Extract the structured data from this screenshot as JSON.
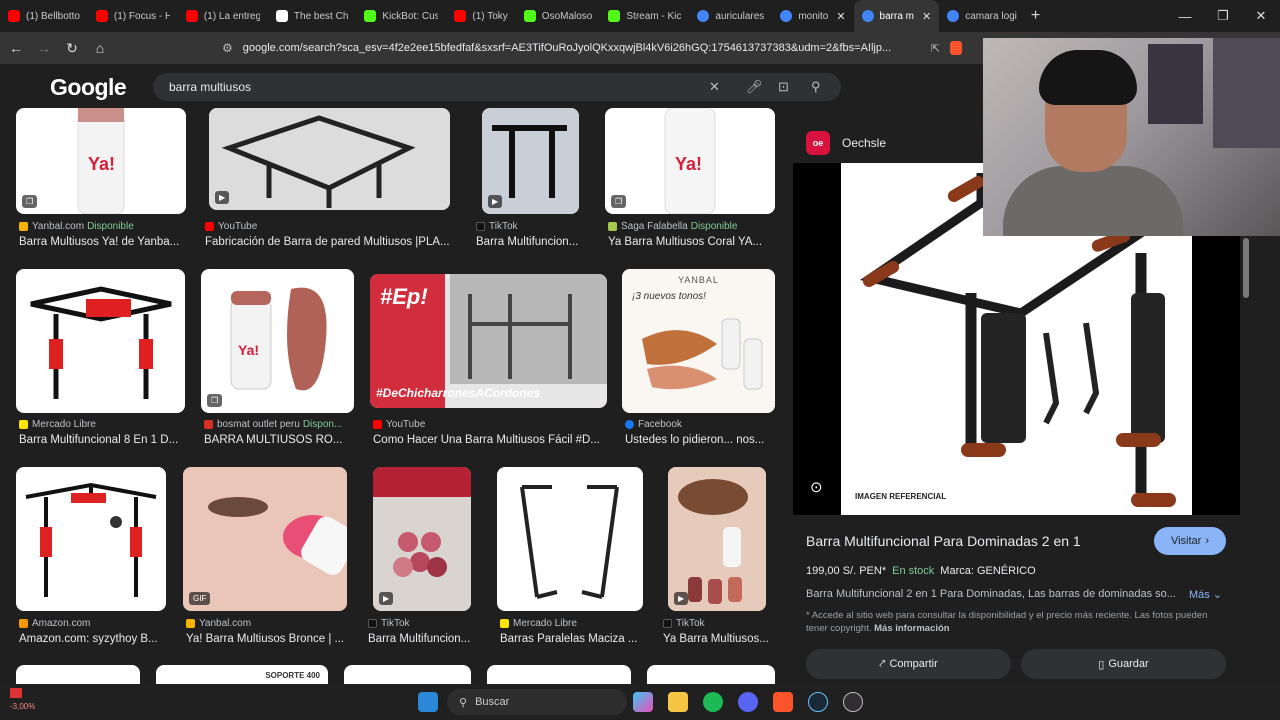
{
  "tabs": [
    {
      "title": "(1) Bellbotto",
      "color": "#ff0000"
    },
    {
      "title": "(1) Focus - H",
      "color": "#ff0000"
    },
    {
      "title": "(1) La entreg",
      "color": "#ff0000"
    },
    {
      "title": "The best Ch",
      "color": "#ffffff"
    },
    {
      "title": "KickBot: Cus",
      "color": "#53fc18"
    },
    {
      "title": "(1) Toky",
      "color": "#ff0000"
    },
    {
      "title": "OsoMaloso",
      "color": "#53fc18"
    },
    {
      "title": "Stream - Kic",
      "color": "#53fc18"
    },
    {
      "title": "auriculares",
      "color": "#4285f4"
    },
    {
      "title": "monito",
      "color": "#4285f4"
    },
    {
      "title": "barra m",
      "color": "#4285f4"
    },
    {
      "title": "camara logi",
      "color": "#4285f4"
    }
  ],
  "url": "google.com/search?sca_esv=4f2e2ee15bfedfaf&sxsrf=AE3TifOuRoJyolQKxxqwjBl4kV6i26hGQ:1754613737383&udm=2&fbs=AIljp...",
  "google_logo": "Google",
  "query": "barra multiusos",
  "results": [
    {
      "source": "Yanbal.com",
      "avail": "Disponible",
      "caption": "Barra Multiusos Ya! de Yanba...",
      "src_color": "#f4b400"
    },
    {
      "source": "YouTube",
      "avail": "",
      "caption": "Fabricación de Barra de pared Multiusos |PLA...",
      "src_color": "#ff0000"
    },
    {
      "source": "TikTok",
      "avail": "",
      "caption": "Barra Multifuncion...",
      "src_color": "#111111"
    },
    {
      "source": "Saga Falabella",
      "avail": "Disponible",
      "caption": "Ya Barra Multiusos Coral YA...",
      "src_color": "#a3c94c"
    },
    {
      "source": "Mercado Libre",
      "avail": "",
      "caption": "Barra Multifuncional 8 En 1 D...",
      "src_color": "#ffe600"
    },
    {
      "source": "bosmat outlet peru",
      "avail": "Dispon...",
      "caption": "BARRA MULTIUSOS RO...",
      "src_color": "#d93025"
    },
    {
      "source": "YouTube",
      "avail": "",
      "caption": "Como Hacer Una Barra Multiusos Fácil #D...",
      "src_color": "#ff0000"
    },
    {
      "source": "Facebook",
      "avail": "",
      "caption": "Ustedes lo pidieron... nos...",
      "src_color": "#1877f2"
    },
    {
      "source": "Amazon.com",
      "avail": "",
      "caption": "Amazon.com: syzythoy B...",
      "src_color": "#ff9900"
    },
    {
      "source": "Yanbal.com",
      "avail": "",
      "caption": "Ya! Barra Multiusos Bronce | ...",
      "src_color": "#f4b400"
    },
    {
      "source": "TikTok",
      "avail": "",
      "caption": "Barra Multifuncion...",
      "src_color": "#111111"
    },
    {
      "source": "Mercado Libre",
      "avail": "",
      "caption": "Barras Paralelas Maciza ...",
      "src_color": "#ffe600"
    },
    {
      "source": "TikTok",
      "avail": "",
      "caption": "Ya Barra Multiusos...",
      "src_color": "#111111"
    }
  ],
  "thumb_texts": {
    "gif": "GIF",
    "el_chicharrones": "#DeChicharronesACordones",
    "yanbal_header": "YANBAL",
    "tonos": "¡3 nuevos tonos!",
    "soporte": "SOPORTE 400"
  },
  "panel": {
    "site": "Oechsle",
    "site_logo": "oe",
    "image_label": "IMAGEN REFERENCIAL",
    "title": "Barra Multifuncional Para Dominadas 2 en 1",
    "visit": "Visitar",
    "price": "199,00 S/. PEN*",
    "stock": "En stock",
    "brand": "Marca: GENÉRICO",
    "description": "Barra Multifuncional 2 en 1 Para Dominadas, Las barras de dominadas so...",
    "more": "Más",
    "note": "* Accede al sitio web para consultar la disponibilidad y el precio más reciente. Las fotos pueden tener copyright.",
    "more_info": "Más información",
    "share": "Compartir",
    "save": "Guardar"
  },
  "taskbar": {
    "search_label": "Buscar",
    "weather_value": "-3,00%"
  }
}
